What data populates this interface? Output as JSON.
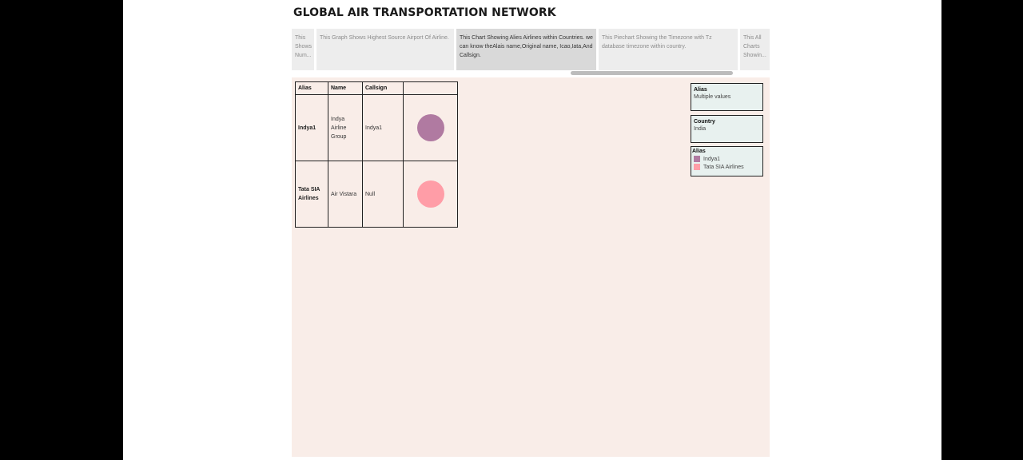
{
  "dashboard_title": "GLOBAL AIR TRANSPORTATION NETWORK",
  "story_points": [
    {
      "text": "This Shows Num...",
      "active": false
    },
    {
      "text": "This Graph Shows Highest Source Airport Of Airline.",
      "active": false
    },
    {
      "text": "This Chart Showing Alies Airlines within Countries. we can know theAlais name,Original name, Icao,Iata,And Callsign.",
      "active": true
    },
    {
      "text": "This Piechart Showing the Timezone with Tz database timezone within country.",
      "active": false
    },
    {
      "text": "This All Charts Showin...",
      "active": false
    }
  ],
  "table": {
    "headers": [
      "Alias",
      "Name",
      "Callsign",
      ""
    ],
    "rows": [
      {
        "alias": "Indya1",
        "name": "Indya Airline Group",
        "callsign": "Indya1",
        "color": "#b07aa1"
      },
      {
        "alias": "Tata SIA Airlines",
        "name": "Air Vistara",
        "callsign": "Null",
        "color": "#ff9da7"
      }
    ]
  },
  "filters": {
    "alias_filter": {
      "label": "Alias",
      "value": "Multiple values"
    },
    "country_filter": {
      "label": "Country",
      "value": "India"
    }
  },
  "legend": {
    "title": "Alias",
    "items": [
      {
        "label": "Indya1",
        "color": "#b07aa1"
      },
      {
        "label": "Tata SIA Airlines",
        "color": "#ff9da7"
      }
    ]
  }
}
